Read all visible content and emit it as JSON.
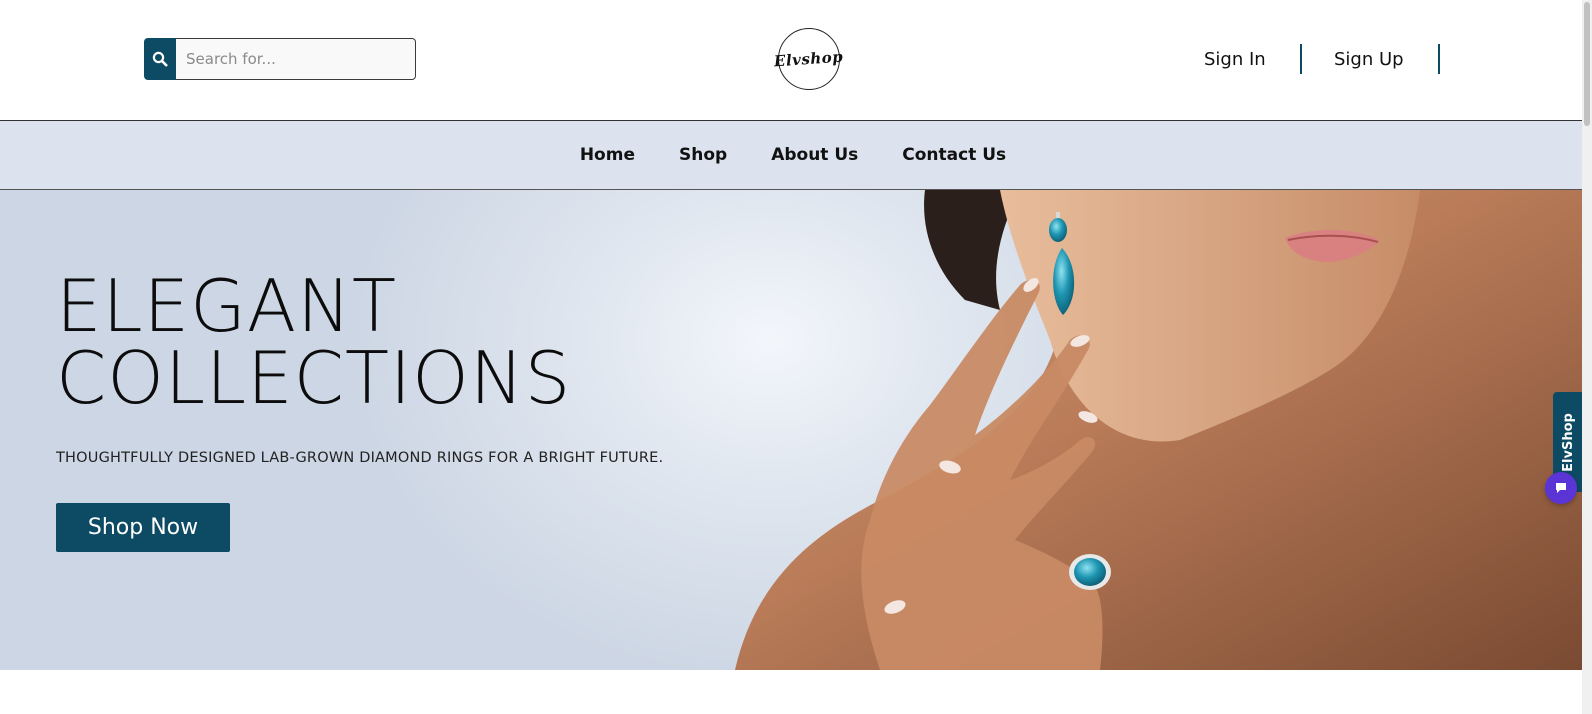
{
  "header": {
    "search": {
      "placeholder": "Search for...",
      "icon": "search-icon"
    },
    "logo_text": "Elvshop",
    "sign_in_label": "Sign In",
    "sign_up_label": "Sign Up"
  },
  "nav": {
    "items": [
      {
        "label": "Home"
      },
      {
        "label": "Shop"
      },
      {
        "label": "About Us"
      },
      {
        "label": "Contact Us"
      }
    ]
  },
  "hero": {
    "title_line1": "ELEGANT",
    "title_line2": "COLLECTIONS",
    "subtitle": "THOUGHTFULLY DESIGNED LAB-GROWN DIAMOND RINGS FOR A BRIGHT FUTURE.",
    "cta_label": "Shop Now",
    "image": "woman-wearing-blue-gem-earring-and-ring"
  },
  "widgets": {
    "side_tab_label": "ElvShop",
    "chat_icon": "chat-icon"
  },
  "colors": {
    "accent": "#0d4a63",
    "nav_background": "#dde3ee",
    "chat_button": "#5b34d6"
  }
}
